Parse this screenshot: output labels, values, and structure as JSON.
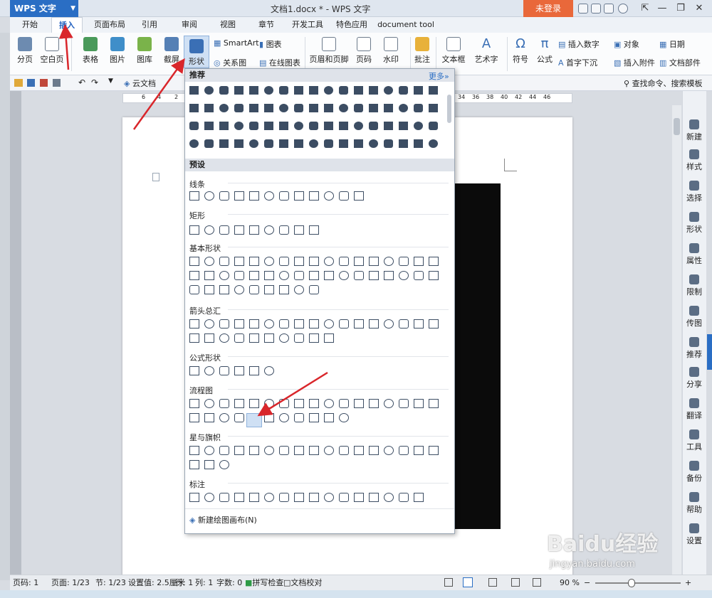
{
  "app": {
    "name": "WPS 文字",
    "doc_title": "文档1.docx * - WPS 文字",
    "login": "未登录"
  },
  "tabs": [
    "开始",
    "插入",
    "页面布局",
    "引用",
    "审阅",
    "视图",
    "章节",
    "开发工具",
    "特色应用",
    "document tool"
  ],
  "ribbon": {
    "page_break": "分页",
    "blank_page": "空白页",
    "table": "表格",
    "picture": "图片",
    "gallery": "图库",
    "screenshot": "截屏",
    "shape": "形状",
    "smartart": "SmartArt",
    "chart": "图表",
    "relation": "关系图",
    "online_chart": "在线图表",
    "header_footer": "页眉和页脚",
    "page_num": "页码",
    "watermark": "水印",
    "comment": "批注",
    "textbox": "文本框",
    "wordart": "艺术字",
    "symbol": "符号",
    "formula": "公式",
    "insert_number": "插入数字",
    "object": "对象",
    "date": "日期",
    "drop_cap": "首字下沉",
    "attachment": "插入附件",
    "doc_parts": "文档部件"
  },
  "quickbar": {
    "cloud_doc": "云文档",
    "search": "查找命令、搜索模板"
  },
  "dropdown": {
    "recommend": "推荐",
    "more": "更多»",
    "preset": "预设",
    "sections": {
      "lines": "线条",
      "rect": "矩形",
      "basic": "基本形状",
      "arrows": "箭头总汇",
      "formula": "公式形状",
      "flow": "流程图",
      "stars": "星与旗帜",
      "callouts": "标注"
    },
    "new_canvas": "新建绘图画布(N)"
  },
  "right_panel": [
    "新建",
    "样式",
    "选择",
    "形状",
    "属性",
    "限制",
    "传图",
    "推荐",
    "分享",
    "翻译",
    "工具",
    "备份",
    "帮助",
    "设置"
  ],
  "status": {
    "page_code": "页码: 1",
    "pages": "页面: 1/23",
    "section": "节: 1/23",
    "setting": "设置值: 2.5厘米",
    "row": "行: 1",
    "col": "列: 1",
    "words": "字数: 0",
    "spell": "拼写检查",
    "proof": "文档校对",
    "zoom": "90 %"
  },
  "ruler_numbers": [
    "6",
    "4",
    "2",
    "34",
    "36",
    "38",
    "40",
    "42",
    "44",
    "46"
  ],
  "watermark": {
    "logo": "Baidu经验",
    "url": "jingyan.baidu.com"
  },
  "colors": {
    "accent": "#2a6ec4",
    "login": "#e9683a",
    "arrow": "#d9262b",
    "shape": "#3c4d63"
  }
}
